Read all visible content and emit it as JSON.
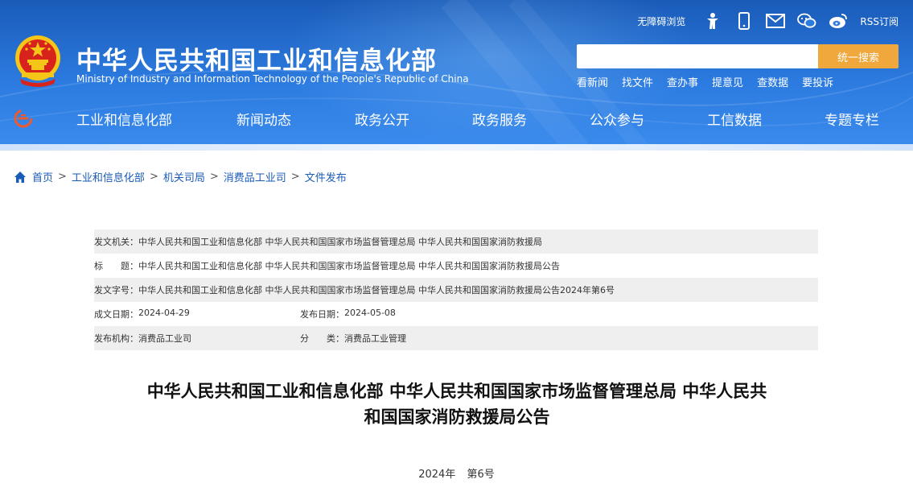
{
  "header": {
    "site_title": "中华人民共和国工业和信息化部",
    "site_subtitle": "Ministry of Industry and Information Technology of the People's Republic of China",
    "accessibility_label": "无障碍浏览",
    "rss_label": "RSS订阅",
    "tool_icons": [
      "accessibility-person-icon",
      "mobile-phone-icon",
      "mail-icon",
      "wechat-icon",
      "weibo-icon"
    ],
    "search": {
      "placeholder": "",
      "button_label": "统一搜索"
    },
    "quick_links": [
      "看新闻",
      "找文件",
      "查办事",
      "提意见",
      "查数据",
      "要投诉"
    ],
    "nav": [
      "工业和信息化部",
      "新闻动态",
      "政务公开",
      "政务服务",
      "公众参与",
      "工信数据",
      "专题专栏"
    ],
    "colors": {
      "header_blue": "#2c7be0",
      "search_button": "#f0a83c",
      "emblem_red": "#d7231c",
      "emblem_gold": "#f5c518"
    }
  },
  "breadcrumb": [
    "首页",
    "工业和信息化部",
    "机关司局",
    "消费品工业司",
    "文件发布"
  ],
  "info": {
    "issuer_label": "发文机关：",
    "issuer": "中华人民共和国工业和信息化部 中华人民共和国国家市场监督管理总局 中华人民共和国国家消防救援局",
    "title_label": "标　　题：",
    "title": "中华人民共和国工业和信息化部 中华人民共和国国家市场监督管理总局 中华人民共和国国家消防救援局公告",
    "doc_no_label": "发文字号：",
    "doc_no": "中华人民共和国工业和信息化部 中华人民共和国国家市场监督管理总局 中华人民共和国国家消防救援局公告2024年第6号",
    "created_label": "成文日期：",
    "created": "2024-04-29",
    "published_label": "发布日期：",
    "published": "2024-05-08",
    "org_label": "发布机构：",
    "org": "消费品工业司",
    "category_label": "分　　类：",
    "category": "消费品工业管理"
  },
  "article": {
    "title_line1": "中华人民共和国工业和信息化部 中华人民共和国国家市场监督管理总局 中华人民共",
    "title_line2": "和国国家消防救援局公告",
    "year": "2024年",
    "number": "第6号"
  }
}
